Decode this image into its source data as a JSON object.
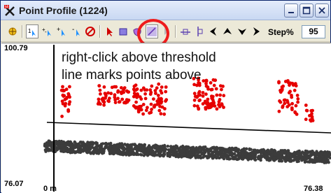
{
  "window": {
    "title": "Point Profile (1224)",
    "icon": "point-profile-app-icon",
    "controls": [
      "minimize-icon",
      "maximize-icon",
      "close-icon"
    ]
  },
  "toolbar": {
    "buttons": [
      "sun-shading-icon",
      "one-point-select-icon",
      "add-plus-minus-icon",
      "add-point-icon",
      "remove-point-icon",
      "no-selection-icon",
      "pointer-arrow-icon",
      "rectangle-select-icon",
      "polygon-select-icon",
      "line-threshold-icon",
      "chevron-right-icon",
      "align-horizontal-icon",
      "align-vertical-icon",
      "step-left-icon",
      "step-up-icon",
      "step-down-icon",
      "step-right-icon"
    ],
    "step_label": "Step%",
    "step_value": "95"
  },
  "highlight": {
    "color": "#ee1c1c",
    "target": "line-threshold-icon"
  },
  "plot": {
    "y_top": "100.79",
    "y_bottom": "76.07",
    "x_left": "0 m",
    "x_right": "76.38",
    "annotation_line1": "right-click above threshold",
    "annotation_line2": "line marks points above",
    "colors": {
      "ground_points": "#3c3c3c",
      "selected_points": "#e60000",
      "threshold_line": "#000000"
    }
  }
}
